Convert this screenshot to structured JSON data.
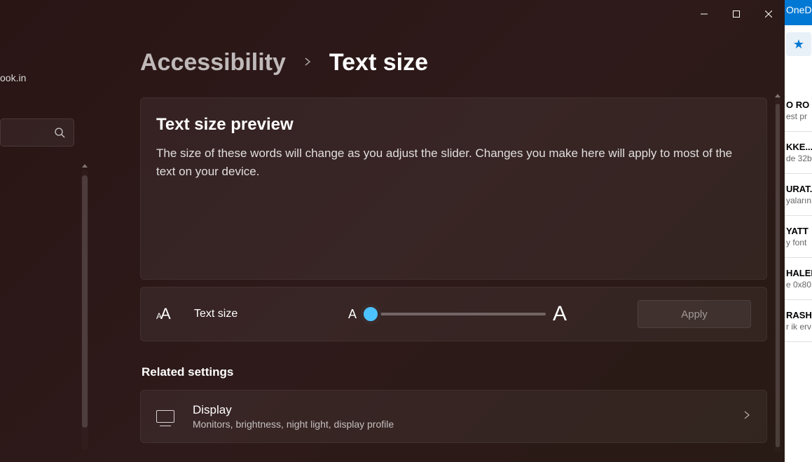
{
  "titlebar": {
    "app_partial": "OneD"
  },
  "left": {
    "account_partial": "ook.in"
  },
  "breadcrumb": {
    "parent": "Accessibility",
    "current": "Text size"
  },
  "preview": {
    "title": "Text size preview",
    "description": "The size of these words will change as you adjust the slider. Changes you make here will apply to most of the text on your device."
  },
  "slider": {
    "label": "Text size",
    "marker_small": "A",
    "marker_large": "A",
    "apply_label": "Apply"
  },
  "related": {
    "header": "Related settings",
    "display": {
      "title": "Display",
      "subtitle": "Monitors, brightness, night light, display profile"
    }
  },
  "background_items": [
    {
      "title": "O RO",
      "sub": "est pr"
    },
    {
      "title": "KKE...",
      "sub": "de 32b"
    },
    {
      "title": "URAT.",
      "sub": "yaların"
    },
    {
      "title": "YATT",
      "sub": "y font"
    },
    {
      "title": "HALED",
      "sub": "e 0x80"
    },
    {
      "title": "RASH",
      "sub": "r ik erv"
    }
  ]
}
